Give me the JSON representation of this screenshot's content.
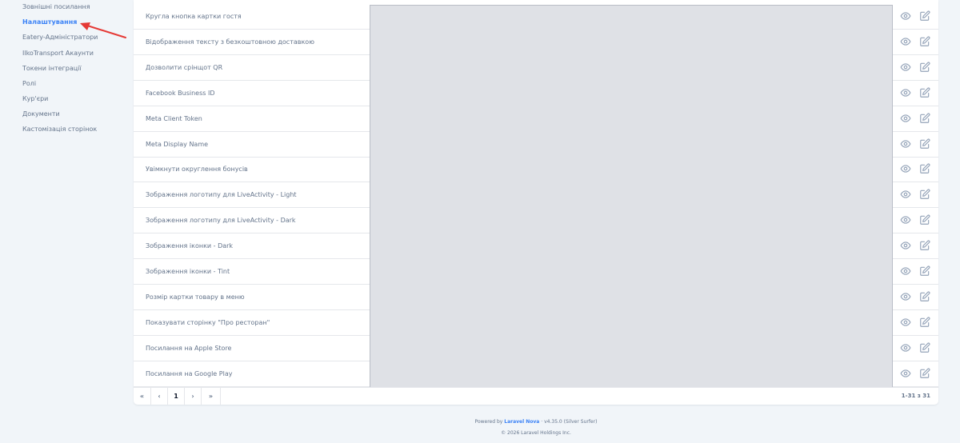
{
  "sidebar": {
    "items": [
      {
        "label": "Зовнішні посилання",
        "active": false
      },
      {
        "label": "Налаштування",
        "active": true
      },
      {
        "label": "Eatery-Адміністратори",
        "active": false
      },
      {
        "label": "IlkoTransport Акаунти",
        "active": false
      },
      {
        "label": "Токени інтеграції",
        "active": false
      },
      {
        "label": "Ролі",
        "active": false
      },
      {
        "label": "Кур'єри",
        "active": false
      },
      {
        "label": "Документи",
        "active": false
      },
      {
        "label": "Кастомізація сторінок",
        "active": false
      }
    ]
  },
  "table": {
    "rows": [
      {
        "label": "Кругла кнопка картки гостя"
      },
      {
        "label": "Відображення тексту з безкоштовною доставкою"
      },
      {
        "label": "Дозволити срінщот QR"
      },
      {
        "label": "Facebook Business ID"
      },
      {
        "label": "Meta Client Token"
      },
      {
        "label": "Meta Display Name"
      },
      {
        "label": "Увімкнути округлення бонусів"
      },
      {
        "label": "Зображення логотипу для LiveActivity - Light"
      },
      {
        "label": "Зображення логотипу для LiveActivity - Dark"
      },
      {
        "label": "Зображення іконки - Dark"
      },
      {
        "label": "Зображення іконки - Tint"
      },
      {
        "label": "Розмір картки товару в меню"
      },
      {
        "label": "Показувати сторінку \"Про ресторан\""
      },
      {
        "label": "Посилання на Apple Store"
      },
      {
        "label": "Посилання на Google Play"
      }
    ],
    "row_icons": {
      "view": "eye-icon",
      "edit": "edit-icon"
    }
  },
  "pagination": {
    "first": "«",
    "prev": "‹",
    "page": "1",
    "next": "›",
    "last": "»",
    "count": "1-31 з 31"
  },
  "footer": {
    "powered_by": "Powered by",
    "brand": "Laravel Nova",
    "version": "· v4.35.0 (Silver Surfer)",
    "copyright": "© 2026 Laravel Holdings Inc."
  },
  "colors": {
    "accent": "#3b82f6",
    "background": "#f1f5f9",
    "annotation_arrow": "#e53935"
  }
}
